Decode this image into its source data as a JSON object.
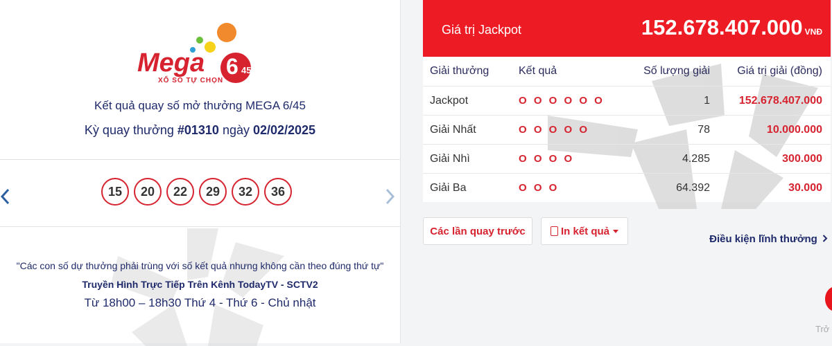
{
  "left": {
    "logo": {
      "brand": "Mega",
      "digits": "6",
      "sub_digits": "45",
      "tagline": "XỔ SỐ TỰ CHỌN"
    },
    "title_line": "Kết quả quay số mở thưởng MEGA 6/45",
    "draw_prefix": "Kỳ quay thưởng ",
    "draw_number": "#01310",
    "draw_middle": " ngày ",
    "draw_date": "02/02/2025",
    "balls": [
      "15",
      "20",
      "22",
      "29",
      "32",
      "36"
    ],
    "prev_icon": "chevron-left-icon",
    "next_icon": "chevron-right-icon",
    "quote": "\"Các con số dự thưởng phải trùng với số kết quả nhưng không cần theo đúng thứ tự\"",
    "broadcast": "Truyền Hình Trực Tiếp Trên Kênh TodayTV - SCTV2",
    "schedule": "Từ 18h00 – 18h30 Thứ 4 - Thứ 6 - Chủ nhật"
  },
  "jackpot": {
    "label": "Giá trị Jackpot",
    "value": "152.678.407.000",
    "unit": "VNĐ"
  },
  "table": {
    "headers": [
      "Giải thưởng",
      "Kết quả",
      "Số lượng giải",
      "Giá trị giải (đồng)"
    ],
    "rows": [
      {
        "prize": "Jackpot",
        "result": "O O O O O O",
        "count": "1",
        "value": "152.678.407.000"
      },
      {
        "prize": "Giải Nhất",
        "result": "O O O O O",
        "count": "78",
        "value": "10.000.000"
      },
      {
        "prize": "Giải Nhì",
        "result": "O O O O",
        "count": "4.285",
        "value": "300.000"
      },
      {
        "prize": "Giải Ba",
        "result": "O O O",
        "count": "64.392",
        "value": "30.000"
      }
    ]
  },
  "buttons": {
    "previous_draws": "Các lần quay trước",
    "print_results": "In kết quả",
    "conditions": "Điều kiện lĩnh thưởng"
  },
  "footer": {
    "back_to_top_partial": "Trở"
  },
  "colors": {
    "accent_red": "#ed1c24",
    "ball_border": "#d6232f",
    "navy": "#1f2a6b"
  }
}
